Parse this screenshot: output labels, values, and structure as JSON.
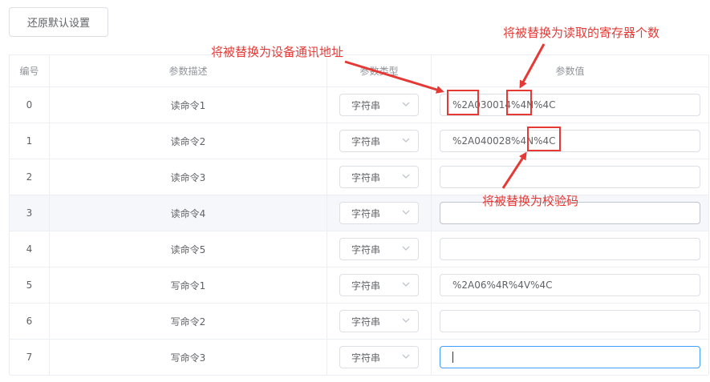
{
  "toolbar": {
    "reset_label": "还原默认设置"
  },
  "table": {
    "headers": [
      "编号",
      "参数描述",
      "参数类型",
      "参数值"
    ],
    "rows": [
      {
        "id": "0",
        "desc": "读命令1",
        "type": "字符串",
        "value": "%2A030014%4N%4C"
      },
      {
        "id": "1",
        "desc": "读命令2",
        "type": "字符串",
        "value": "%2A040028%4N%4C"
      },
      {
        "id": "2",
        "desc": "读命令3",
        "type": "字符串",
        "value": ""
      },
      {
        "id": "3",
        "desc": "读命令4",
        "type": "字符串",
        "value": ""
      },
      {
        "id": "4",
        "desc": "读命令5",
        "type": "字符串",
        "value": ""
      },
      {
        "id": "5",
        "desc": "写命令1",
        "type": "字符串",
        "value": "%2A06%4R%4V%4C"
      },
      {
        "id": "6",
        "desc": "写命令2",
        "type": "字符串",
        "value": ""
      },
      {
        "id": "7",
        "desc": "写命令3",
        "type": "字符串",
        "value": ""
      }
    ]
  },
  "annotations": {
    "address": "将被替换为设备通讯地址",
    "count": "将被替换为读取的寄存器个数",
    "checksum": "将被替换为校验码"
  },
  "colors": {
    "annotation": "#e53935",
    "focus": "#409eff",
    "border": "#dcdfe6"
  }
}
